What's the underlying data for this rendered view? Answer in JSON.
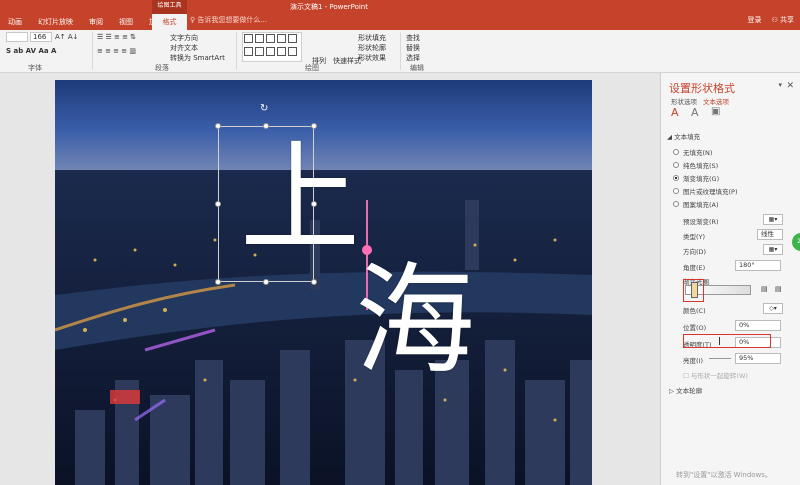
{
  "window": {
    "title": "演示文稿1 - PowerPoint",
    "drawing_tools": "绘图工具",
    "active_tab": "格式",
    "tellme": "告诉我您想要做什么...",
    "signin": "登录",
    "share": "共享"
  },
  "menu": [
    "动画",
    "幻灯片放映",
    "审阅",
    "视图",
    "加载项"
  ],
  "ribbon": {
    "font_size": "166",
    "text_direction": "文字方向",
    "align_text": "对齐文本",
    "convert_smartart": "转换为 SmartArt",
    "arrange": "排列",
    "quick_styles": "快速样式",
    "shape_fill": "形状填充",
    "shape_outline": "形状轮廓",
    "shape_effects": "形状效果",
    "find": "查找",
    "replace": "替换",
    "select": "选择",
    "groups": [
      "字体",
      "段落",
      "绘图",
      "编辑"
    ]
  },
  "slide": {
    "char1": "上",
    "char2": "海"
  },
  "panel": {
    "title": "设置形状格式",
    "tab_shape": "形状选项",
    "tab_text": "文本选项",
    "section_fill": "文本填充",
    "fill_options": [
      "无填充(N)",
      "纯色填充(S)",
      "渐变填充(G)",
      "图片或纹理填充(P)",
      "图案填充(A)"
    ],
    "selected_fill": 2,
    "preset_gradient": "预设渐变(R)",
    "type_label": "类型(Y)",
    "type_value": "线性",
    "direction_label": "方向(D)",
    "angle_label": "角度(E)",
    "angle_value": "180°",
    "gradient_stops": "渐变光圈",
    "color_label": "颜色(C)",
    "position_label": "位置(O)",
    "position_value": "0%",
    "transparency_label": "透明度(T)",
    "transparency_value": "0%",
    "brightness_label": "亮度(I)",
    "brightness_value": "95%",
    "rotate_with_shape": "与形状一起旋转(W)",
    "section_outline": "文本轮廓"
  },
  "badge": "20",
  "activate": "转到\"设置\"以激活 Windows。",
  "colors": {
    "accent": "#c6432b",
    "highlight": "#d7362c"
  }
}
